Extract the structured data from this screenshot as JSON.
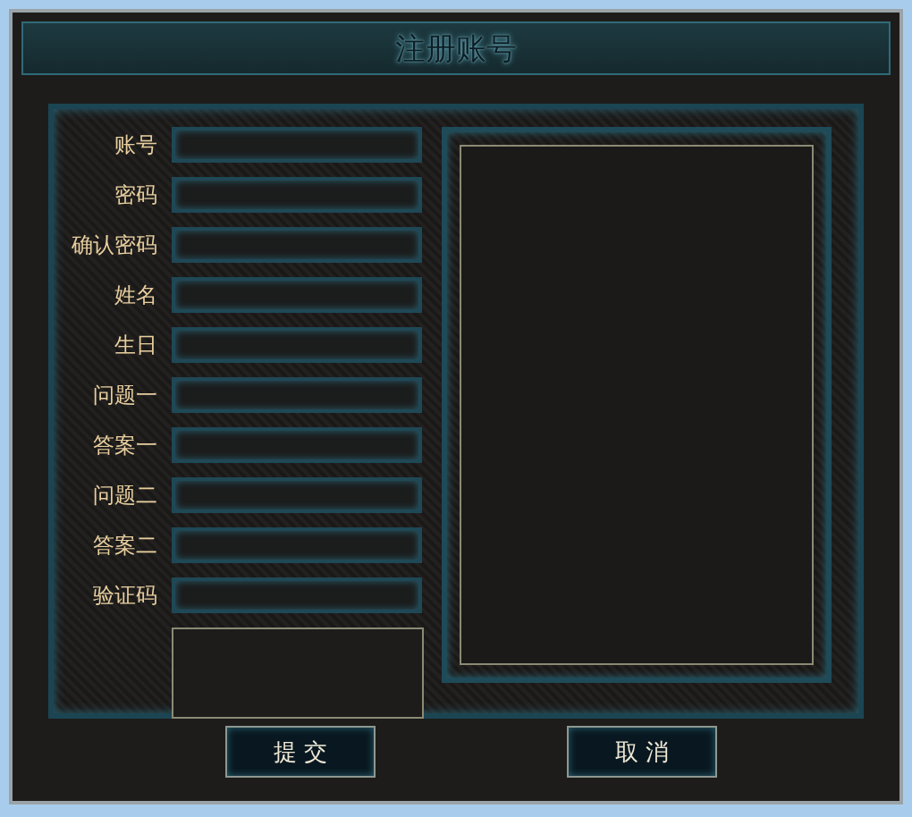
{
  "window": {
    "title": "注册账号"
  },
  "fields": [
    {
      "label": "账号"
    },
    {
      "label": "密码"
    },
    {
      "label": "确认密码"
    },
    {
      "label": "姓名"
    },
    {
      "label": "生日"
    },
    {
      "label": "问题一"
    },
    {
      "label": "答案一"
    },
    {
      "label": "问题二"
    },
    {
      "label": "答案二"
    },
    {
      "label": "验证码"
    }
  ],
  "buttons": [
    {
      "label": "提 交"
    },
    {
      "label": "取 消"
    }
  ]
}
